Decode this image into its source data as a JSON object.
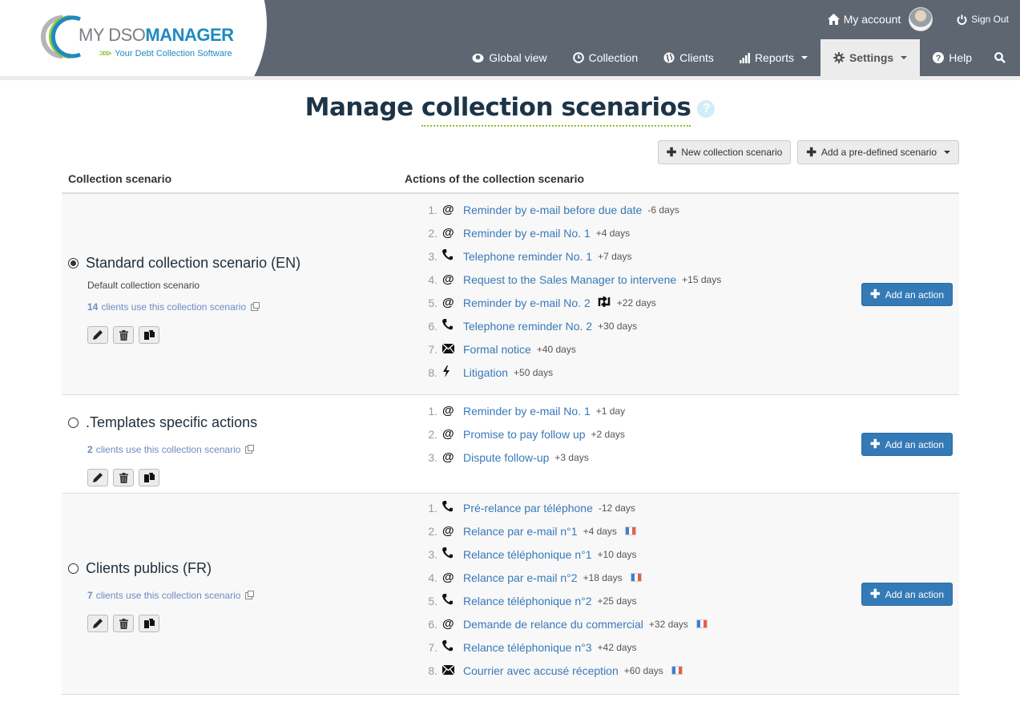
{
  "brand": {
    "logo_my": "MY DSO",
    "logo_manager": "MANAGER",
    "tagline": "Your Debt Collection Software",
    "arrows": ">>>"
  },
  "topbar": {
    "my_account": "My account",
    "sign_out": "Sign Out"
  },
  "nav": [
    {
      "label": "Global view",
      "icon": "eye-icon",
      "active": false
    },
    {
      "label": "Collection",
      "icon": "clock-icon",
      "active": false
    },
    {
      "label": "Clients",
      "icon": "globe-icon",
      "active": false
    },
    {
      "label": "Reports",
      "icon": "bar-chart-icon",
      "active": false,
      "dropdown": true
    },
    {
      "label": "Settings",
      "icon": "gear-icon",
      "active": true,
      "dropdown": true
    },
    {
      "label": "Help",
      "icon": "question-icon",
      "active": false
    }
  ],
  "page": {
    "title_prefix": "Manage ",
    "title_underlined": "collection scenarios",
    "help": "?"
  },
  "toolbar": {
    "new_scenario": "New collection scenario",
    "add_predefined": "Add a pre-defined scenario"
  },
  "table": {
    "col_scenario": "Collection scenario",
    "col_actions": "Actions of the collection scenario"
  },
  "add_action_label": "Add an action",
  "scenarios": [
    {
      "name": "Standard collection scenario (EN)",
      "selected": true,
      "description": "Default collection scenario",
      "clients_count": "14",
      "clients_text": "clients use this collection scenario",
      "actions": [
        {
          "num": "1.",
          "icon": "email-icon",
          "label": "Reminder by e-mail before due date",
          "delay": "-6 days"
        },
        {
          "num": "2.",
          "icon": "email-icon",
          "label": "Reminder by e-mail No. 1",
          "delay": "+4 days"
        },
        {
          "num": "3.",
          "icon": "phone-icon",
          "label": "Telephone reminder No. 1",
          "delay": "+7 days"
        },
        {
          "num": "4.",
          "icon": "email-icon",
          "label": "Request to the Sales Manager to intervene",
          "delay": "+15 days"
        },
        {
          "num": "5.",
          "icon": "email-icon",
          "label": "Reminder by e-mail No. 2",
          "delay": "+22 days",
          "repeat": true
        },
        {
          "num": "6.",
          "icon": "phone-icon",
          "label": "Telephone reminder No. 2",
          "delay": "+30 days"
        },
        {
          "num": "7.",
          "icon": "envelope-icon",
          "label": "Formal notice",
          "delay": "+40 days"
        },
        {
          "num": "8.",
          "icon": "lightning-icon",
          "label": "Litigation",
          "delay": "+50 days"
        }
      ]
    },
    {
      "name": ".Templates specific actions",
      "selected": false,
      "description": "",
      "clients_count": "2",
      "clients_text": "clients use this collection scenario",
      "actions": [
        {
          "num": "1.",
          "icon": "email-icon",
          "label": "Reminder by e-mail No. 1",
          "delay": "+1 day"
        },
        {
          "num": "2.",
          "icon": "email-icon",
          "label": "Promise to pay follow up",
          "delay": "+2 days"
        },
        {
          "num": "3.",
          "icon": "email-icon",
          "label": "Dispute follow-up",
          "delay": "+3 days"
        }
      ]
    },
    {
      "name": "Clients publics (FR)",
      "selected": false,
      "description": "",
      "clients_count": "7",
      "clients_text": "clients use this collection scenario",
      "actions": [
        {
          "num": "1.",
          "icon": "phone-icon",
          "label": "Pré-relance par téléphone",
          "delay": "-12 days"
        },
        {
          "num": "2.",
          "icon": "email-icon",
          "label": "Relance par e-mail n°1",
          "delay": "+4 days",
          "flag": "fr"
        },
        {
          "num": "3.",
          "icon": "phone-icon",
          "label": "Relance téléphonique n°1",
          "delay": "+10 days"
        },
        {
          "num": "4.",
          "icon": "email-icon",
          "label": "Relance par e-mail n°2",
          "delay": "+18 days",
          "flag": "fr"
        },
        {
          "num": "5.",
          "icon": "phone-icon",
          "label": "Relance téléphonique n°2",
          "delay": "+25 days"
        },
        {
          "num": "6.",
          "icon": "email-icon",
          "label": "Demande de relance du commercial",
          "delay": "+32 days",
          "flag": "fr"
        },
        {
          "num": "7.",
          "icon": "phone-icon",
          "label": "Relance téléphonique n°3",
          "delay": "+42 days"
        },
        {
          "num": "8.",
          "icon": "envelope-icon",
          "label": "Courrier avec accusé réception",
          "delay": "+60 days",
          "flag": "fr"
        }
      ]
    }
  ],
  "colors": {
    "header_bg": "#5d6671",
    "brand_blue": "#1f8ac0",
    "brand_green": "#8dc63f",
    "link": "#3879b9",
    "primary_button": "#337ab7"
  }
}
